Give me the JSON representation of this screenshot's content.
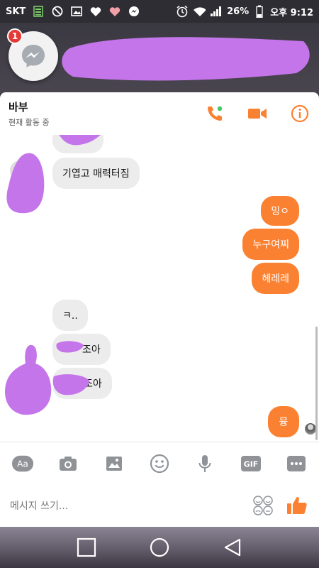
{
  "status_bar": {
    "carrier": "SKT",
    "battery_percent": "26%",
    "time": "오후 9:12",
    "notification_icons": [
      "sim-icon",
      "blocked-icon",
      "gallery-icon",
      "heart-icon",
      "heart-pink-icon",
      "messenger-icon"
    ],
    "system_icons": [
      "alarm-icon",
      "wifi-icon",
      "signal-icon",
      "battery-icon"
    ]
  },
  "chat_head": {
    "unread_badge": "1",
    "icon": "messenger-icon"
  },
  "header": {
    "title": "바부",
    "subtitle": "현재 활동 중",
    "accent_color": "#fb8132",
    "actions": [
      "phone-icon",
      "video-camera-icon",
      "info-icon"
    ],
    "online_dot_color": "#44c767"
  },
  "messages": [
    {
      "side": "in",
      "text": "기엽고 매력터짐"
    },
    {
      "side": "out",
      "text": "밍ㅇ"
    },
    {
      "side": "out",
      "text": "누구여찌"
    },
    {
      "side": "out",
      "text": "헤레레"
    },
    {
      "side": "in",
      "text": "ㅋ.."
    },
    {
      "side": "in",
      "text": "조아"
    },
    {
      "side": "in",
      "text": "조아"
    },
    {
      "side": "out",
      "text": "뮹"
    }
  ],
  "composer": {
    "tools": [
      "text-style-icon",
      "camera-icon",
      "image-icon",
      "emoji-icon",
      "microphone-icon",
      "gif-icon",
      "more-icon"
    ],
    "tool_labels": {
      "aa": "Aa",
      "gif": "GIF"
    },
    "placeholder": "메시지 쓰기...",
    "sticker_icon": "sticker-icon",
    "like_icon": "thumbs-up-icon"
  },
  "nav_bar": {
    "buttons": [
      "recent-apps-icon",
      "home-icon",
      "back-icon"
    ]
  }
}
